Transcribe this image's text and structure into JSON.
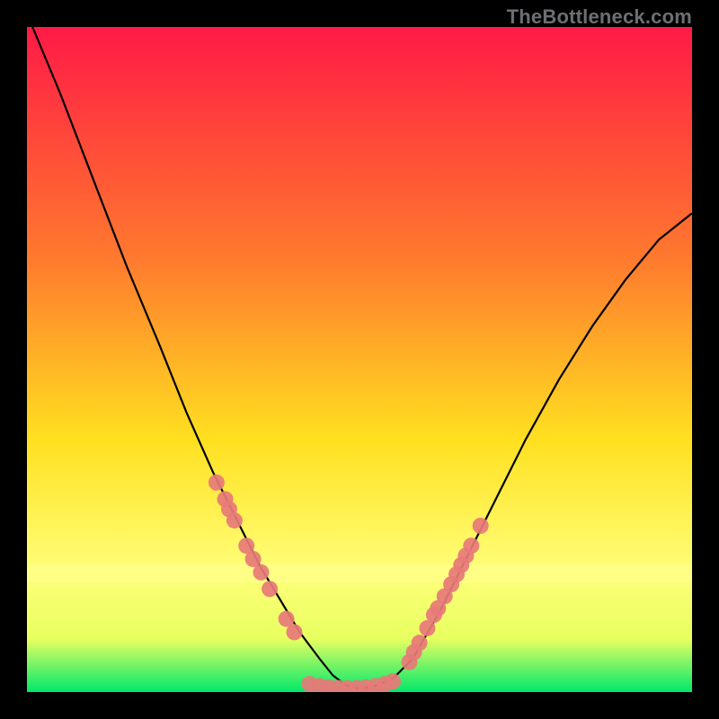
{
  "watermark": "TheBottleneck.com",
  "chart_data": {
    "type": "line",
    "title": "",
    "xlabel": "",
    "ylabel": "",
    "xlim": [
      0,
      100
    ],
    "ylim": [
      0,
      100
    ],
    "background_gradient": {
      "top": "#ff1a46",
      "mid_upper": "#ff7a2e",
      "mid": "#ffe020",
      "band": "#ffff7a",
      "bottom": "#00e86b"
    },
    "curve": {
      "name": "bottleneck-curve",
      "x": [
        0,
        5,
        10,
        15,
        20,
        24,
        28,
        32,
        35,
        38,
        41,
        44,
        46,
        48,
        50,
        52,
        55,
        58,
        62,
        66,
        70,
        75,
        80,
        85,
        90,
        95,
        100
      ],
      "y": [
        102,
        90,
        77,
        64,
        52,
        42,
        33,
        25,
        19,
        14,
        9,
        5,
        2.5,
        1,
        0.5,
        0.8,
        2,
        5,
        12,
        20,
        28,
        38,
        47,
        55,
        62,
        68,
        72
      ]
    },
    "left_points": {
      "name": "left-branch-markers",
      "color": "#e77a78",
      "x": [
        28.5,
        29.8,
        30.4,
        31.2,
        33.0,
        34.0,
        35.2,
        36.5,
        39.0,
        40.2
      ],
      "y": [
        31.5,
        29.0,
        27.5,
        25.8,
        22.0,
        20.0,
        18.0,
        15.5,
        11.0,
        9.0
      ]
    },
    "right_points": {
      "name": "right-branch-markers",
      "color": "#e77a78",
      "x": [
        57.5,
        58.2,
        59.0,
        60.2,
        61.2,
        61.8,
        62.8,
        63.8,
        64.6,
        65.3,
        66.0,
        66.8,
        68.2
      ],
      "y": [
        4.5,
        6.0,
        7.4,
        9.6,
        11.6,
        12.6,
        14.4,
        16.2,
        17.7,
        19.1,
        20.5,
        22.0,
        25.0
      ]
    },
    "bottom_points": {
      "name": "trough-markers",
      "color": "#e77a78",
      "x": [
        42.5,
        44.0,
        45.4,
        46.8,
        48.2,
        49.6,
        51.0,
        52.4,
        53.8,
        55.0
      ],
      "y": [
        1.2,
        0.9,
        0.7,
        0.6,
        0.55,
        0.6,
        0.7,
        0.9,
        1.2,
        1.6
      ]
    }
  }
}
